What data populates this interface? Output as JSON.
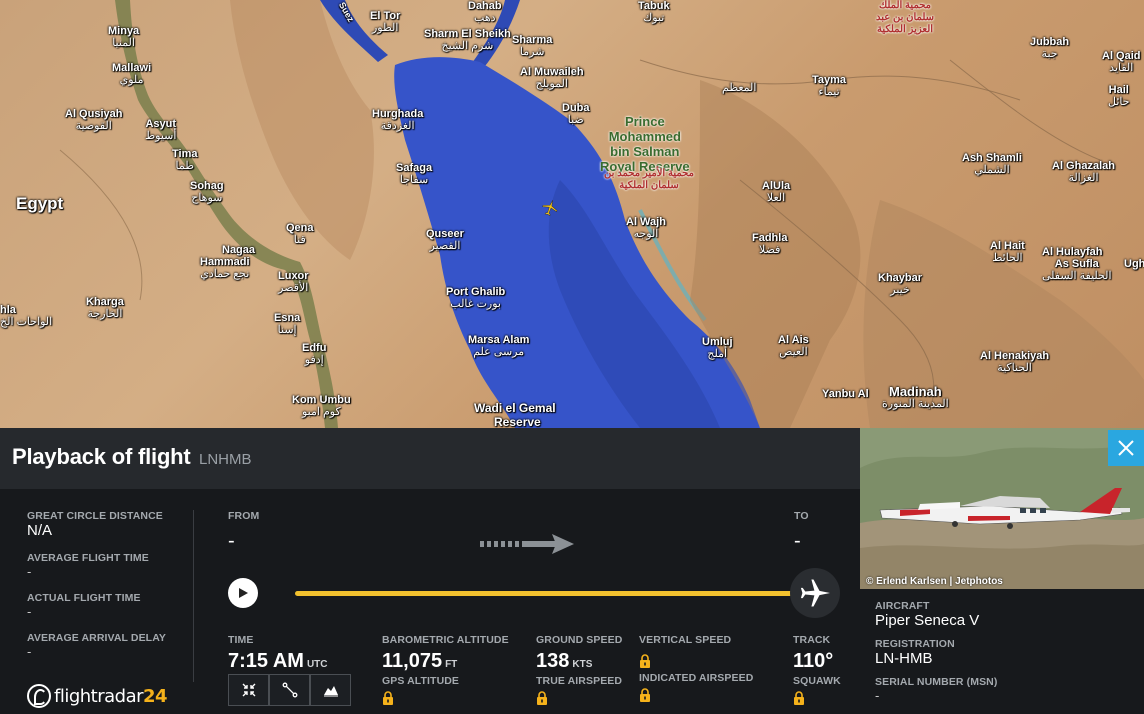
{
  "map": {
    "labels": [
      {
        "id": "minya",
        "name": "Minya",
        "ar": "المنيا"
      },
      {
        "id": "mallawi",
        "name": "Mallawi",
        "ar": "ملوي"
      },
      {
        "id": "alqusiyah",
        "name": "Al Qusiyah",
        "ar": "القوصية"
      },
      {
        "id": "asyut",
        "name": "Asyut",
        "ar": "أسيوط"
      },
      {
        "id": "tima",
        "name": "Tima",
        "ar": "طما"
      },
      {
        "id": "sohag",
        "name": "Sohag",
        "ar": "سوهاج"
      },
      {
        "id": "egypt",
        "name": "Egypt",
        "ar": ""
      },
      {
        "id": "qena",
        "name": "Qena",
        "ar": "قنا"
      },
      {
        "id": "nagaa",
        "name": "Nagaa",
        "ar": ""
      },
      {
        "id": "hammadi",
        "name": "Hammadi",
        "ar": "نجع حمادي"
      },
      {
        "id": "luxor",
        "name": "Luxor",
        "ar": "الأقصر"
      },
      {
        "id": "kharga",
        "name": "Kharga",
        "ar": "الخارجة"
      },
      {
        "id": "esna",
        "name": "Esna",
        "ar": "إسنا"
      },
      {
        "id": "edfu",
        "name": "Edfu",
        "ar": "إدفو"
      },
      {
        "id": "komumbu",
        "name": "Kom Umbu",
        "ar": "كوم امبو"
      },
      {
        "id": "eltor",
        "name": "El Tor",
        "ar": "الطور"
      },
      {
        "id": "dahab",
        "name": "Dahab",
        "ar": "دهب"
      },
      {
        "id": "sharm",
        "name": "Sharm El Sheikh",
        "ar": "شرم الشيخ"
      },
      {
        "id": "sharma",
        "name": "Sharma",
        "ar": "شرما"
      },
      {
        "id": "tabuk",
        "name": "Tabuk",
        "ar": "تبوك"
      },
      {
        "id": "almuwaileh",
        "name": "Al Muwaileh",
        "ar": "المويلح"
      },
      {
        "id": "hurghada",
        "name": "Hurghada",
        "ar": "الغردقة"
      },
      {
        "id": "duba",
        "name": "Duba",
        "ar": "ضبا"
      },
      {
        "id": "safaga",
        "name": "Safaga",
        "ar": "سفاجا"
      },
      {
        "id": "quseer",
        "name": "Quseer",
        "ar": "القصير"
      },
      {
        "id": "portghalib",
        "name": "Port Ghalib",
        "ar": "بورت غالب"
      },
      {
        "id": "marsaalam",
        "name": "Marsa Alam",
        "ar": "مرسى علم"
      },
      {
        "id": "wadielgemal",
        "name": "Wadi el Gemal",
        "ar": ""
      },
      {
        "id": "reserve",
        "name": "Reserve",
        "ar": ""
      },
      {
        "id": "almutam",
        "name": "",
        "ar": "المعظم"
      },
      {
        "id": "tayma",
        "name": "Tayma",
        "ar": "تيماء"
      },
      {
        "id": "alwajh",
        "name": "Al Wajh",
        "ar": "الوجه"
      },
      {
        "id": "alula",
        "name": "AlUla",
        "ar": "العلا"
      },
      {
        "id": "fadhla",
        "name": "Fadhla",
        "ar": "فضلا"
      },
      {
        "id": "umluj",
        "name": "Umluj",
        "ar": "أملج"
      },
      {
        "id": "alais",
        "name": "Al Ais",
        "ar": "العيص"
      },
      {
        "id": "khaybar",
        "name": "Khaybar",
        "ar": "خيبر"
      },
      {
        "id": "alhait",
        "name": "Al Hait",
        "ar": "الحائط"
      },
      {
        "id": "alhulayfah",
        "name": "Al Hulayfah",
        "ar": ""
      },
      {
        "id": "assufla",
        "name": "As Sufla",
        "ar": "الحليفة السفلى"
      },
      {
        "id": "alhenakiyah",
        "name": "Al Henakiyah",
        "ar": "الحناكية"
      },
      {
        "id": "madinah",
        "name": "Madinah",
        "ar": "المدينة المنورة"
      },
      {
        "id": "yanbu",
        "name": "Yanbu Al",
        "ar": ""
      },
      {
        "id": "ashshamli",
        "name": "Ash Shamli",
        "ar": "الشملي"
      },
      {
        "id": "alghazalah",
        "name": "Al Ghazalah",
        "ar": "الغزالة"
      },
      {
        "id": "jubbah",
        "name": "Jubbah",
        "ar": "جبة"
      },
      {
        "id": "alqaid",
        "name": "Al Qaid",
        "ar": "القايد"
      },
      {
        "id": "hail",
        "name": "Hail",
        "ar": "حائل"
      },
      {
        "id": "ughl",
        "name": "Ughl",
        "ar": ""
      },
      {
        "id": "alwahat",
        "name": "hla",
        "ar": "الواحات الخ"
      }
    ],
    "reserve_label": {
      "l1": "Prince",
      "l2": "Mohammed",
      "l3": "bin Salman",
      "l4": "Royal Reserve",
      "ar": "محمية الأمير محمد بن سلمان الملكية"
    },
    "topright_ar": "محمية الملك سلمان بن عبد العزيز الملكية",
    "suez_label": "Suez"
  },
  "panel": {
    "title": "Playback of flight",
    "callsign": "LNHMB",
    "stats": [
      {
        "label": "GREAT CIRCLE DISTANCE",
        "value": "N/A"
      },
      {
        "label": "AVERAGE FLIGHT TIME",
        "value": "-"
      },
      {
        "label": "ACTUAL FLIGHT TIME",
        "value": "-"
      },
      {
        "label": "AVERAGE ARRIVAL DELAY",
        "value": "-"
      }
    ],
    "from_label": "FROM",
    "from_value": "-",
    "to_label": "TO",
    "to_value": "-",
    "time_label": "TIME",
    "time_value": "7:15 AM",
    "time_unit": "UTC",
    "baro_label": "BAROMETRIC ALTITUDE",
    "baro_value": "11,075",
    "baro_unit": "FT",
    "gps_label": "GPS ALTITUDE",
    "gs_label": "GROUND SPEED",
    "gs_value": "138",
    "gs_unit": "KTS",
    "tas_label": "TRUE AIRSPEED",
    "vs_label": "VERTICAL SPEED",
    "ias_label": "INDICATED AIRSPEED",
    "track_label": "TRACK",
    "track_value": "110°",
    "squawk_label": "SQUAWK",
    "playback_progress": 1.0
  },
  "logo": {
    "text": "flightradar",
    "num": "24"
  },
  "side": {
    "photo_credit": "© Erlend Karlsen | Jetphotos",
    "aircraft_label": "AIRCRAFT",
    "aircraft_value": "Piper Seneca V",
    "registration_label": "REGISTRATION",
    "registration_value": "LN-HMB",
    "msn_label": "SERIAL NUMBER (MSN)",
    "msn_value": "-"
  },
  "colors": {
    "accent": "#f2c12e",
    "close": "#2aa7e0",
    "sea": "#3654c9",
    "panel": "#17191c"
  }
}
